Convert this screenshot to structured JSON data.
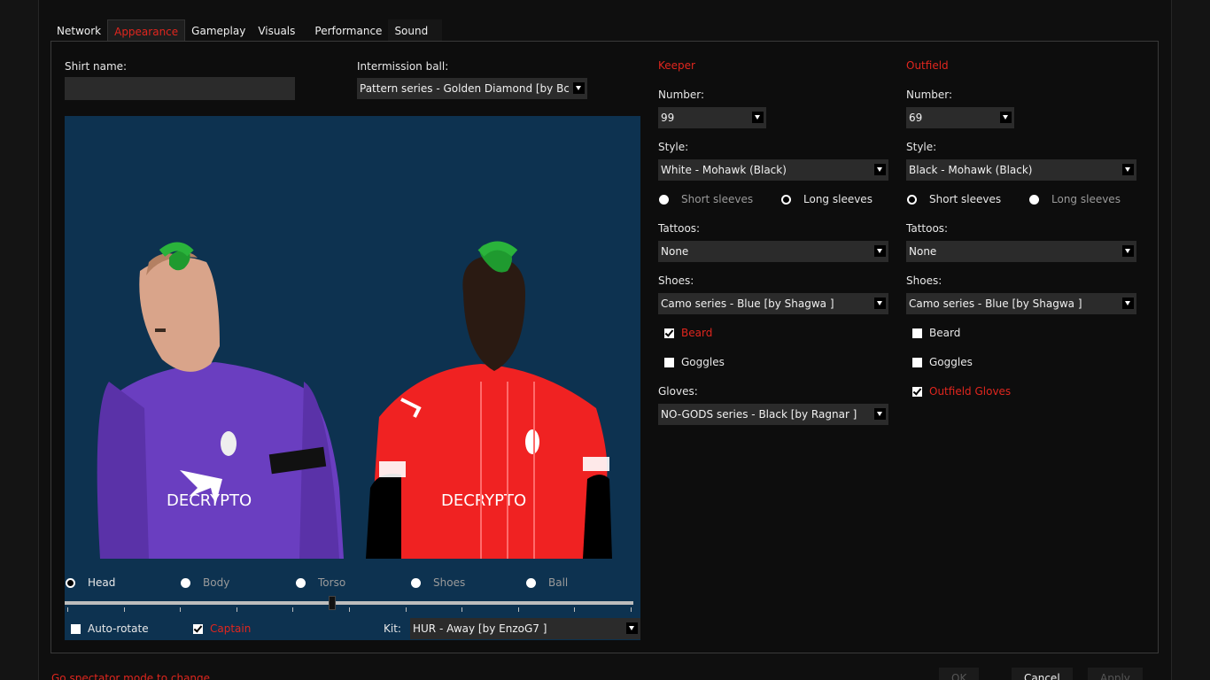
{
  "tabs": [
    "Network",
    "Appearance",
    "Gameplay",
    "Visuals",
    "Performance",
    "Sound"
  ],
  "left": {
    "shirt_name_label": "Shirt name:",
    "shirt_name_value": "",
    "intermission_label": "Intermission ball:",
    "intermission_value": "Pattern series - Golden Diamond   [by Bcom"
  },
  "view_modes": [
    {
      "label": "Head",
      "selected": true
    },
    {
      "label": "Body",
      "selected": false
    },
    {
      "label": "Torso",
      "selected": false
    },
    {
      "label": "Shoes",
      "selected": false
    },
    {
      "label": "Ball",
      "selected": false
    }
  ],
  "zoom_slider_fraction": 0.47,
  "auto_rotate": {
    "label": "Auto-rotate",
    "checked": false
  },
  "captain": {
    "label": "Captain",
    "checked": true
  },
  "kit": {
    "label": "Kit:",
    "value": "HUR - Away   [by EnzoG7 ]"
  },
  "keeper": {
    "title": "Keeper",
    "number_label": "Number:",
    "number": "99",
    "style_label": "Style:",
    "style": "White - Mohawk (Black)",
    "short_sleeves": "Short sleeves",
    "long_sleeves": "Long sleeves",
    "sleeves": "long",
    "tattoos_label": "Tattoos:",
    "tattoos": "None",
    "shoes_label": "Shoes:",
    "shoes": "Camo series - Blue   [by Shagwa ]",
    "beard": {
      "label": "Beard",
      "checked": true
    },
    "goggles": {
      "label": "Goggles",
      "checked": false
    },
    "gloves_label": "Gloves:",
    "gloves": "NO-GODS series - Black   [by Ragnar ]"
  },
  "outfield": {
    "title": "Outfield",
    "number_label": "Number:",
    "number": "69",
    "style_label": "Style:",
    "style": "Black - Mohawk (Black)",
    "short_sleeves": "Short sleeves",
    "long_sleeves": "Long sleeves",
    "sleeves": "short",
    "tattoos_label": "Tattoos:",
    "tattoos": "None",
    "shoes_label": "Shoes:",
    "shoes": "Camo series - Blue   [by Shagwa ]",
    "beard": {
      "label": "Beard",
      "checked": false
    },
    "goggles": {
      "label": "Goggles",
      "checked": false
    },
    "gloves": {
      "label": "Outfield Gloves",
      "checked": true
    }
  },
  "footer": {
    "message": "Go spectator mode to change",
    "ok": "OK",
    "cancel": "Cancel",
    "apply": "Apply"
  },
  "colors": {
    "accent": "#e0261e",
    "viewport_bg": "#0d3250",
    "keeper_kit": "#6a3ec0",
    "outfield_kit": "#f02222",
    "hair": "#1f9a2f"
  }
}
